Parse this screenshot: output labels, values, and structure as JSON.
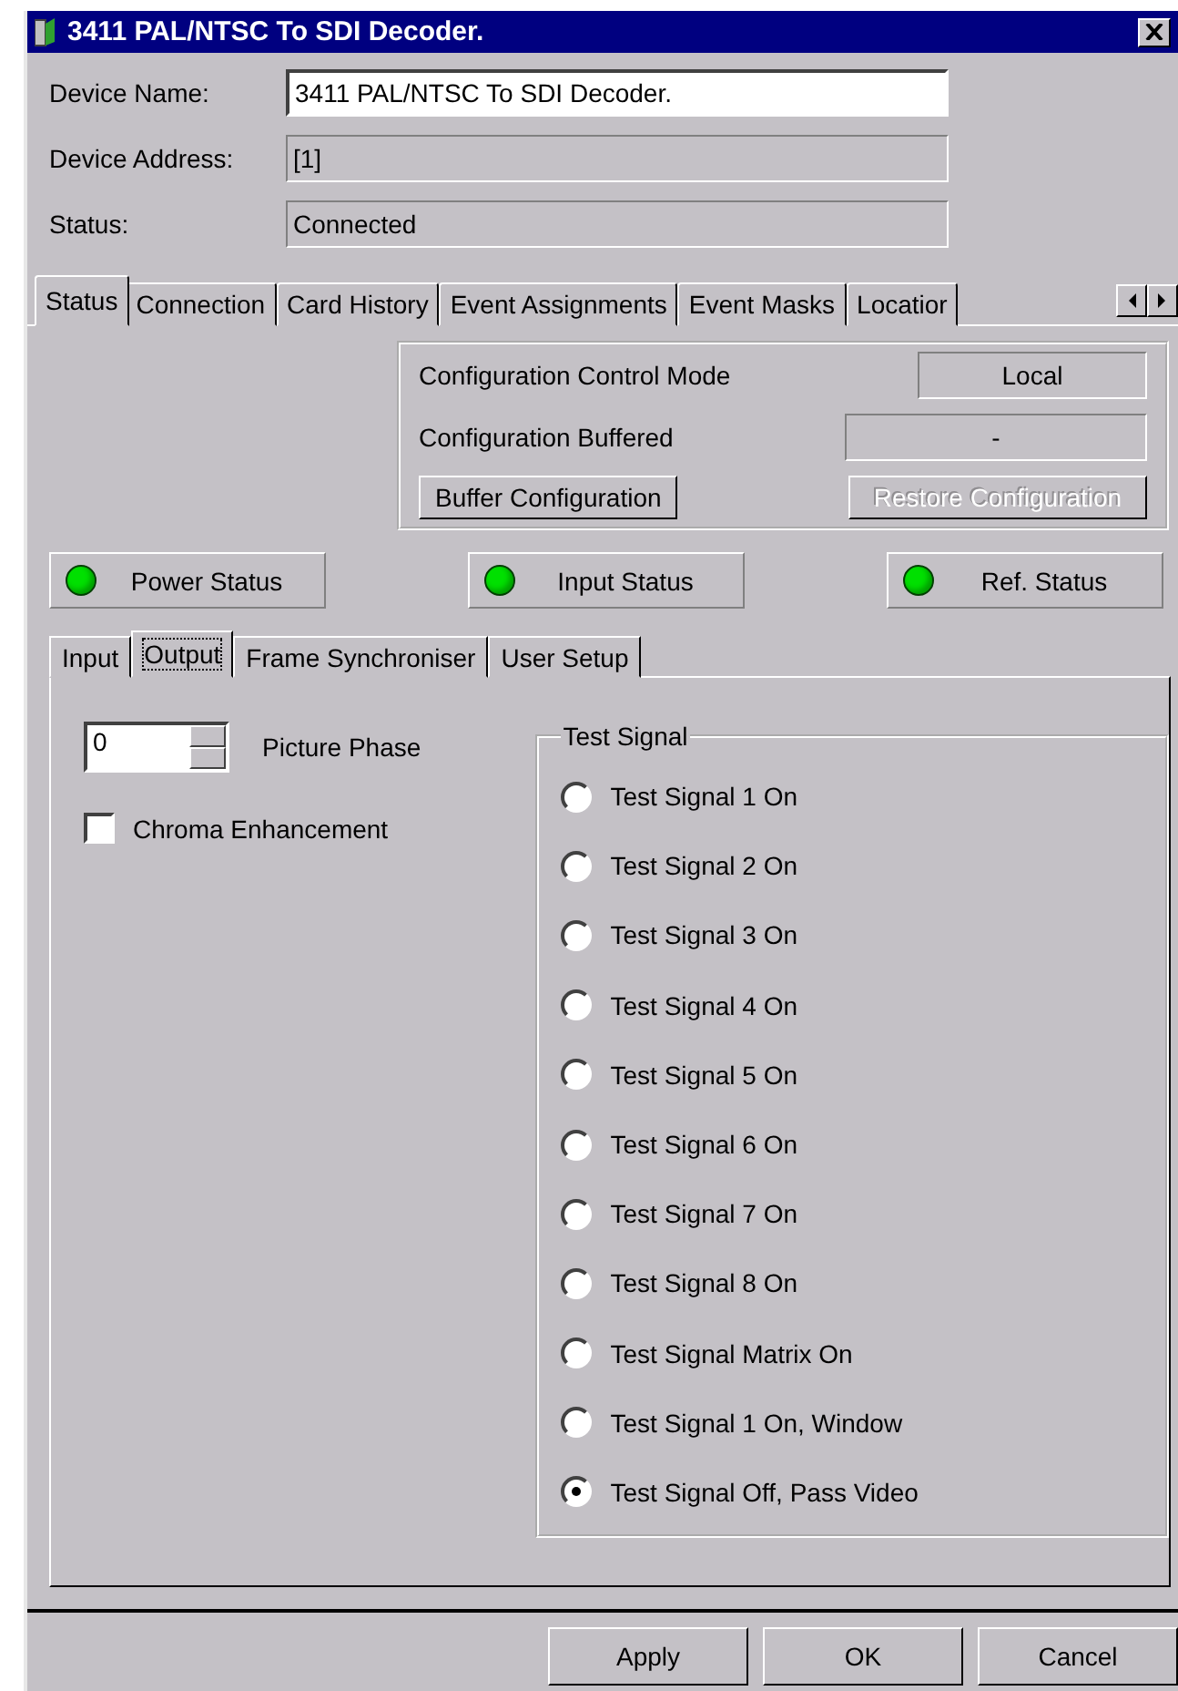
{
  "window": {
    "title": "3411 PAL/NTSC To SDI Decoder."
  },
  "fields": [
    {
      "label": "Device Name:",
      "value": "3411 PAL/NTSC To SDI Decoder.",
      "editable": true
    },
    {
      "label": "Device Address:",
      "value": "[1]",
      "editable": false
    },
    {
      "label": "Status:",
      "value": "Connected",
      "editable": false
    }
  ],
  "tabs": [
    {
      "label": "Status",
      "selected": true
    },
    {
      "label": "Connection",
      "selected": false
    },
    {
      "label": "Card History",
      "selected": false
    },
    {
      "label": "Event Assignments",
      "selected": false
    },
    {
      "label": "Event Masks",
      "selected": false
    },
    {
      "label": "Locatior",
      "selected": false
    }
  ],
  "config": {
    "mode_label": "Configuration Control Mode",
    "mode_value": "Local",
    "buffered_label": "Configuration Buffered",
    "buffered_value": "-",
    "buttons": [
      {
        "label": "Buffer Configuration",
        "disabled": false
      },
      {
        "label": "Restore Configuration",
        "disabled": true
      }
    ]
  },
  "indicators": [
    {
      "label": "Power Status",
      "color": "#00e000"
    },
    {
      "label": "Input Status",
      "color": "#00e000"
    },
    {
      "label": "Ref. Status",
      "color": "#00e000"
    }
  ],
  "subtabs": [
    {
      "label": "Input",
      "selected": false
    },
    {
      "label": "Output",
      "selected": true
    },
    {
      "label": "Frame Synchroniser",
      "selected": false
    },
    {
      "label": "User Setup",
      "selected": false
    }
  ],
  "picture_phase": {
    "value": "0",
    "label": "Picture Phase"
  },
  "chroma": {
    "label": "Chroma Enhancement",
    "checked": false
  },
  "test_signal": {
    "title": "Test Signal",
    "options": [
      {
        "label": "Test Signal 1 On",
        "selected": false
      },
      {
        "label": "Test Signal 2 On",
        "selected": false
      },
      {
        "label": "Test Signal 3 On",
        "selected": false
      },
      {
        "label": "Test Signal 4 On",
        "selected": false
      },
      {
        "label": "Test Signal 5 On",
        "selected": false
      },
      {
        "label": "Test Signal 6 On",
        "selected": false
      },
      {
        "label": "Test Signal 7 On",
        "selected": false
      },
      {
        "label": "Test Signal 8 On",
        "selected": false
      },
      {
        "label": "Test Signal Matrix On",
        "selected": false
      },
      {
        "label": "Test Signal 1 On, Window",
        "selected": false
      },
      {
        "label": "Test Signal Off, Pass Video",
        "selected": true
      }
    ]
  },
  "buttons": [
    "Apply",
    "OK",
    "Cancel"
  ]
}
